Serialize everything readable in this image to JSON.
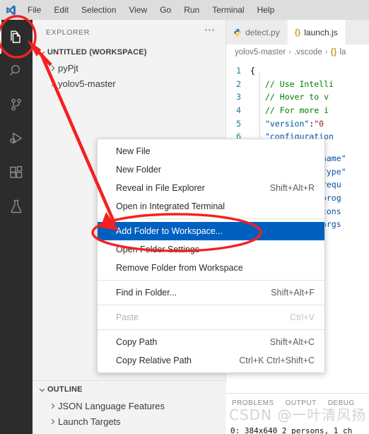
{
  "window": {
    "logo_icon": "vscode-logo",
    "menus": [
      "File",
      "Edit",
      "Selection",
      "View",
      "Go",
      "Run",
      "Terminal",
      "Help"
    ]
  },
  "activitybar": {
    "items": [
      {
        "name": "explorer",
        "icon": "files-icon",
        "active": true
      },
      {
        "name": "search",
        "icon": "search-icon",
        "active": false
      },
      {
        "name": "source-control",
        "icon": "source-control-icon",
        "active": false
      },
      {
        "name": "run-debug",
        "icon": "run-debug-icon",
        "active": false
      },
      {
        "name": "extensions",
        "icon": "extensions-icon",
        "active": false
      },
      {
        "name": "testing",
        "icon": "flask-icon",
        "active": false
      }
    ]
  },
  "explorer": {
    "title": "EXPLORER",
    "more_icon": "ellipsis-icon",
    "workspace": {
      "label": "UNTITLED (WORKSPACE)",
      "expanded": true,
      "chevron_icon": "chevron-down-icon"
    },
    "folders": [
      {
        "label": "pyPjt",
        "chevron_icon": "chevron-right-icon"
      },
      {
        "label": "yolov5-master",
        "chevron_icon": "chevron-right-icon"
      }
    ],
    "outline": {
      "label": "OUTLINE",
      "chevron_icon": "chevron-down-icon",
      "items": [
        {
          "label": "JSON Language Features",
          "chevron_icon": "chevron-right-icon"
        },
        {
          "label": "Launch Targets",
          "chevron_icon": "chevron-right-icon"
        }
      ]
    }
  },
  "editor": {
    "tabs": [
      {
        "label": "detect.py",
        "icon": "python-icon",
        "active": false
      },
      {
        "label": "launch.js",
        "icon": "json-braces-icon",
        "active": true
      }
    ],
    "breadcrumb": [
      "yolov5-master",
      ".vscode",
      "la"
    ],
    "breadcrumb_icon": "json-braces-icon",
    "lines": [
      {
        "num": "1",
        "segments": [
          {
            "t": "{",
            "c": "punct"
          }
        ],
        "indent": 0
      },
      {
        "num": "2",
        "segments": [
          {
            "t": "// Use Intelli",
            "c": "comment"
          }
        ],
        "indent": 2
      },
      {
        "num": "3",
        "segments": [
          {
            "t": "// Hover to v",
            "c": "comment"
          }
        ],
        "indent": 2
      },
      {
        "num": "4",
        "segments": [
          {
            "t": "// For more i",
            "c": "comment"
          }
        ],
        "indent": 2
      },
      {
        "num": "5",
        "segments": [
          {
            "t": "\"version\"",
            "c": "key"
          },
          {
            "t": ": ",
            "c": "punct"
          },
          {
            "t": "\"0",
            "c": "str"
          }
        ],
        "indent": 2
      },
      {
        "num": "6",
        "segments": [
          {
            "t": "\"configuration",
            "c": "key"
          }
        ],
        "indent": 2
      }
    ],
    "lines_lower": [
      {
        "segments": [
          {
            "t": "\"name\"",
            "c": "key"
          }
        ],
        "indent": 4
      },
      {
        "segments": [
          {
            "t": "\"type\"",
            "c": "key"
          }
        ],
        "indent": 4
      },
      {
        "segments": [
          {
            "t": "\"requ",
            "c": "key"
          }
        ],
        "indent": 4
      },
      {
        "segments": [
          {
            "t": "\"prog",
            "c": "key"
          }
        ],
        "indent": 4
      },
      {
        "segments": [
          {
            "t": "\"cons",
            "c": "key"
          }
        ],
        "indent": 4
      },
      {
        "segments": [
          {
            "t": "\"args",
            "c": "key"
          }
        ],
        "indent": 4
      }
    ]
  },
  "context_menu": {
    "items": [
      {
        "label": "New File",
        "shortcut": "",
        "state": "normal"
      },
      {
        "label": "New Folder",
        "shortcut": "",
        "state": "normal"
      },
      {
        "label": "Reveal in File Explorer",
        "shortcut": "Shift+Alt+R",
        "state": "normal"
      },
      {
        "label": "Open in Integrated Terminal",
        "shortcut": "",
        "state": "normal"
      },
      {
        "type": "separator"
      },
      {
        "label": "Add Folder to Workspace...",
        "shortcut": "",
        "state": "highlight"
      },
      {
        "label": "Open Folder Settings",
        "shortcut": "",
        "state": "normal"
      },
      {
        "label": "Remove Folder from Workspace",
        "shortcut": "",
        "state": "normal"
      },
      {
        "type": "separator"
      },
      {
        "label": "Find in Folder...",
        "shortcut": "Shift+Alt+F",
        "state": "normal"
      },
      {
        "type": "separator"
      },
      {
        "label": "Paste",
        "shortcut": "Ctrl+V",
        "state": "disabled"
      },
      {
        "type": "separator"
      },
      {
        "label": "Copy Path",
        "shortcut": "Shift+Alt+C",
        "state": "normal"
      },
      {
        "label": "Copy Relative Path",
        "shortcut": "Ctrl+K Ctrl+Shift+C",
        "state": "normal"
      }
    ]
  },
  "panel": {
    "tabs": [
      {
        "label": "PROBLEMS",
        "active": false
      },
      {
        "label": "OUTPUT",
        "active": false
      },
      {
        "label": "DEBUG",
        "active": false
      }
    ],
    "output_line": "0: 384x640 2 persons, 1 ch"
  },
  "watermark": "CSDN @一叶清风扬",
  "annotations": {
    "color": "#f52020",
    "shapes": [
      "circle-around-explorer-icon",
      "arrow-to-add-folder",
      "ellipse-around-add-folder"
    ]
  }
}
